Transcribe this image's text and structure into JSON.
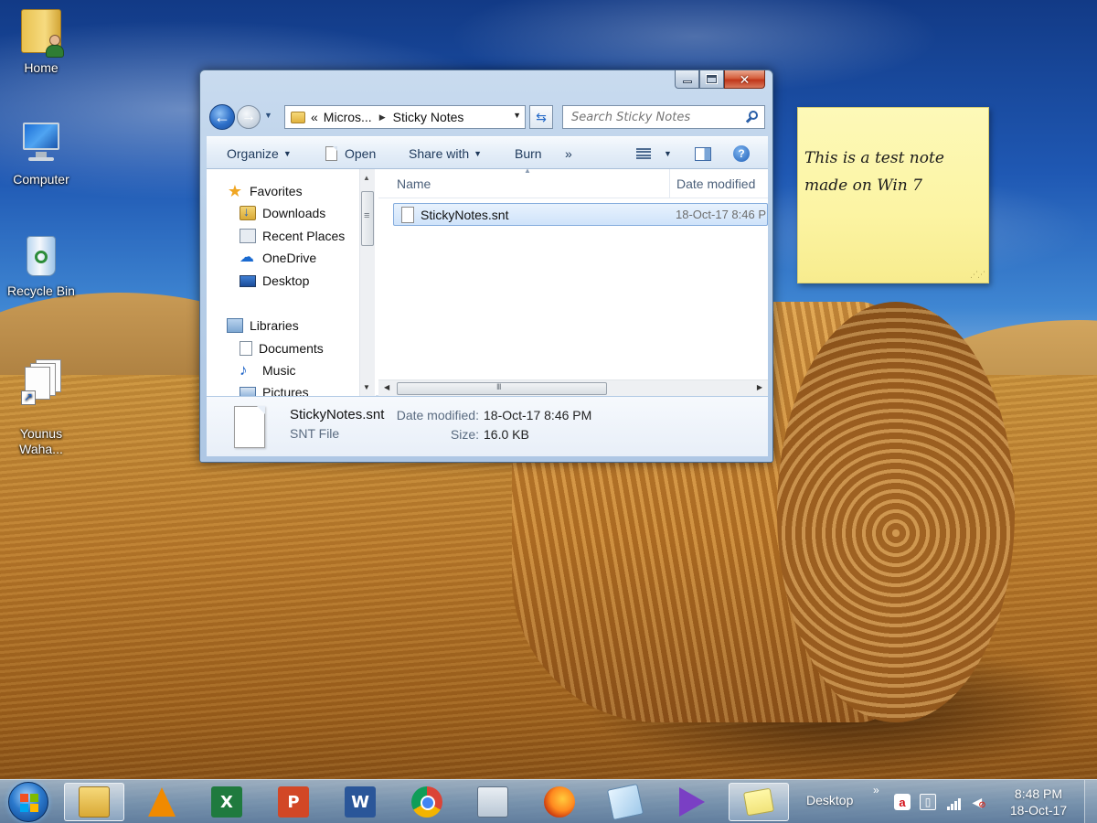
{
  "desktop": {
    "icons": [
      {
        "label": "Home",
        "icon": "user-folder-icon"
      },
      {
        "label": "Computer",
        "icon": "computer-icon"
      },
      {
        "label": "Recycle Bin",
        "icon": "recycle-bin-icon"
      },
      {
        "label": "Younus\nWaha...",
        "icon": "folder-shortcut-icon"
      }
    ]
  },
  "explorer": {
    "breadcrumb": {
      "prefix": "«",
      "parent": "Micros...",
      "current": "Sticky Notes"
    },
    "search": {
      "placeholder": "Search Sticky Notes"
    },
    "toolbar": {
      "organize": "Organize",
      "open": "Open",
      "share_with": "Share with",
      "burn": "Burn",
      "more": "»"
    },
    "nav": {
      "favorites_label": "Favorites",
      "favorites": [
        "Downloads",
        "Recent Places",
        "OneDrive",
        "Desktop"
      ],
      "libraries_label": "Libraries",
      "libraries": [
        "Documents",
        "Music",
        "Pictures"
      ]
    },
    "columns": {
      "name": "Name",
      "date_modified": "Date modified"
    },
    "files": [
      {
        "name": "StickyNotes.snt",
        "date_modified": "18-Oct-17 8:46 P"
      }
    ],
    "details": {
      "name": "StickyNotes.snt",
      "type": "SNT File",
      "date_label": "Date modified:",
      "date_value": "18-Oct-17 8:46 PM",
      "size_label": "Size:",
      "size_value": "16.0 KB"
    }
  },
  "sticky_note": {
    "text": "This is a test note\nmade on Win 7"
  },
  "taskbar": {
    "apps": [
      "file-explorer-icon",
      "vlc-icon",
      "excel-icon",
      "powerpoint-icon",
      "word-icon",
      "chrome-icon",
      "calculator-icon",
      "firefox-icon",
      "notepad-icon",
      "visual-studio-icon",
      "sticky-notes-icon"
    ],
    "desktop_label": "Desktop",
    "overflow": "»",
    "time": "8:48 PM",
    "date": "18-Oct-17"
  },
  "colors": {
    "sky": "#1f58b3",
    "field": "#b8782a",
    "sticky": "#fcf4a3",
    "close_button": "#c0361a"
  }
}
